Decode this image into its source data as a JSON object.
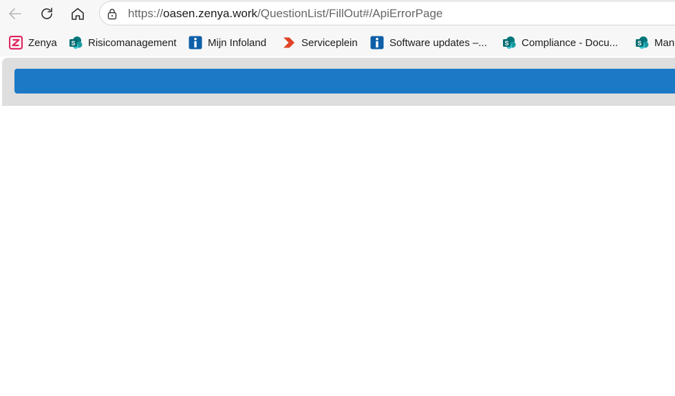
{
  "browser": {
    "address_bar": {
      "url_scheme": "https://",
      "url_host": "oasen.zenya.work",
      "url_path": "/QuestionList/FillOut#/ApiErrorPage"
    },
    "nav": {
      "back_icon": "arrow-left-icon",
      "reload_icon": "reload-icon",
      "home_icon": "home-icon",
      "lock_icon": "lock-icon"
    }
  },
  "bookmarks": [
    {
      "label": "Zenya",
      "icon": "zenya-logo-icon",
      "color": "#e0245e"
    },
    {
      "label": "Risicomanagement",
      "icon": "sharepoint-icon",
      "color": "#077568"
    },
    {
      "label": "Mijn Infoland",
      "icon": "infoland-icon",
      "color": "#0f5fa8"
    },
    {
      "label": "Serviceplein",
      "icon": "serviceplein-icon",
      "color": "#e04427"
    },
    {
      "label": "Software updates –...",
      "icon": "infoland-icon",
      "color": "#0f5fa8"
    },
    {
      "label": "Compliance - Docu...",
      "icon": "sharepoint-icon",
      "color": "#077568"
    },
    {
      "label": "Man",
      "icon": "sharepoint-icon",
      "color": "#077568"
    }
  ],
  "colors": {
    "app_bar": "#1b79c5",
    "header_bg": "#dedede"
  }
}
